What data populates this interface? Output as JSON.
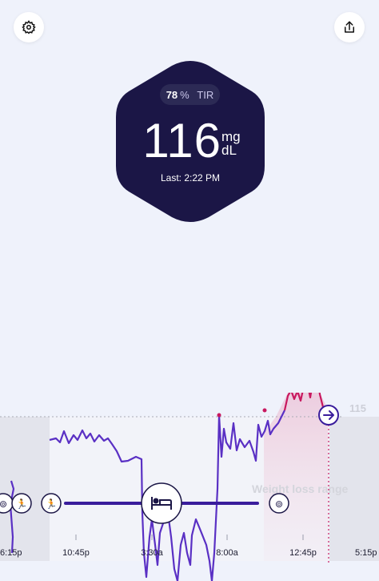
{
  "toolbar": {
    "settings_icon": "gear-icon",
    "share_icon": "share-icon"
  },
  "summary": {
    "tir_value": "78",
    "tir_unit": "%",
    "tir_label": "TIR",
    "glucose_value": "116",
    "glucose_unit_top": "mg",
    "glucose_unit_bottom": "dL",
    "last_reading": "Last: 2:22 PM"
  },
  "colors": {
    "hexagon": "#1b1646",
    "line_in_range": "#5a30c4",
    "line_high": "#c8185f",
    "sleep_bar": "#3a1d9c",
    "band": "#e3e4ec"
  },
  "chart_data": {
    "type": "line",
    "threshold_label": "115",
    "band_label": "Weight loss range",
    "x_tick_labels": [
      "6:15p",
      "10:45p",
      "3:30a",
      "8:00a",
      "12:45p",
      "5:15p"
    ],
    "series": [
      {
        "values": [
          [
            "10:45p",
            84
          ],
          [
            "11:00p",
            85
          ],
          [
            "11:15p",
            82
          ],
          [
            "11:30p",
            88
          ],
          [
            "11:45p",
            83
          ],
          [
            "12:00a",
            87
          ],
          [
            "12:30a",
            81
          ],
          [
            "1:00a",
            85
          ],
          [
            "1:30a",
            80
          ],
          [
            "2:00a",
            76
          ],
          [
            "2:30a",
            72
          ],
          [
            "3:00a",
            71
          ],
          [
            "3:30a",
            60
          ],
          [
            "3:45a",
            30
          ],
          [
            "4:00a",
            52
          ],
          [
            "4:30a",
            28
          ],
          [
            "5:00a",
            64
          ],
          [
            "5:30a",
            42
          ],
          [
            "6:00a",
            30
          ],
          [
            "6:30a",
            45
          ],
          [
            "7:00a",
            48
          ],
          [
            "7:20a",
            18
          ],
          [
            "7:40a",
            106
          ],
          [
            "8:00a",
            85
          ],
          [
            "8:30a",
            94
          ],
          [
            "9:00a",
            88
          ],
          [
            "9:30a",
            96
          ],
          [
            "10:00a",
            82
          ],
          [
            "10:30a",
            105
          ],
          [
            "11:00a",
            95
          ],
          [
            "11:30a",
            110
          ],
          [
            "12:00p",
            116
          ],
          [
            "12:30p",
            128
          ],
          [
            "1:00p",
            132
          ],
          [
            "1:30p",
            122
          ],
          [
            "2:00p",
            135
          ],
          [
            "2:22p",
            116
          ]
        ]
      }
    ],
    "event_markers": [
      "meal-icon",
      "run-icon",
      "run-icon",
      "sleep-icon",
      "meal-icon",
      "arrow-right-icon"
    ]
  }
}
